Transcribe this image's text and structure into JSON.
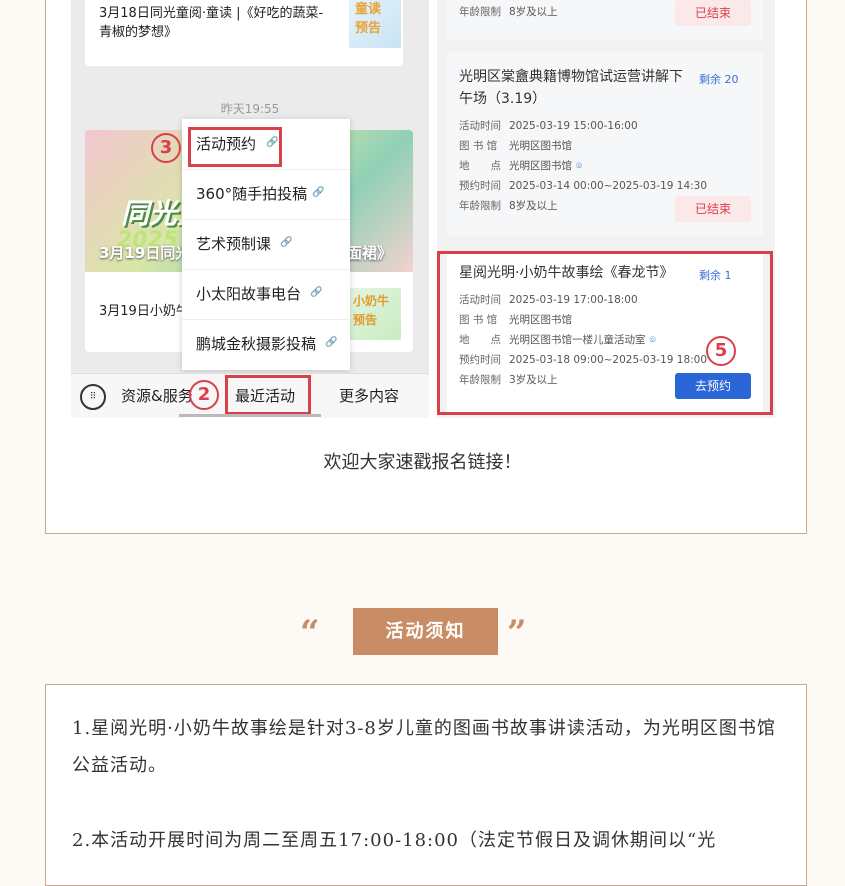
{
  "wechat_panel": {
    "card1_text": "3月18日同光童阅·童读 |《好吃的蔬菜-青椒的梦想》",
    "card1_badge": "童读\n预告",
    "timestamp": "昨天19:55",
    "banner_text": "3月19日同光",
    "banner_big": "同光童",
    "banner_year": "2025",
    "banner_right": "面裙》",
    "card2_text": "3月19日小奶牛",
    "card2_badge": "小奶牛\n预告",
    "popup_items": [
      "活动预约",
      "360°随手拍投稿",
      "艺术预制课",
      "小太阳故事电台",
      "鹏城金秋摄影投稿"
    ],
    "tabs": [
      "资源&服务",
      "最近活动",
      "更多内容"
    ],
    "markers": {
      "m2": "2",
      "m3": "3",
      "m5": "5"
    }
  },
  "activity_panel": {
    "top_card": {
      "age_key": "年龄限制",
      "age_val": "8岁及以上",
      "button": "已结束"
    },
    "card_a": {
      "title": "光明区棠盦典籍博物馆试运营讲解下午场（3.19）",
      "remain": "剩余 20",
      "rows": [
        {
          "k": "活动时间",
          "v": "2025-03-19 15:00-16:00"
        },
        {
          "k": "图 书 馆",
          "v": "光明区图书馆"
        },
        {
          "k": "地　　点",
          "v": "光明区图书馆"
        },
        {
          "k": "预约时间",
          "v": "2025-03-14 00:00~2025-03-19 14:30"
        },
        {
          "k": "年龄限制",
          "v": "8岁及以上"
        }
      ],
      "button": "已结束"
    },
    "card_b": {
      "title": "星阅光明·小奶牛故事绘《春龙节》",
      "remain": "剩余 1",
      "rows": [
        {
          "k": "活动时间",
          "v": "2025-03-19 17:00-18:00"
        },
        {
          "k": "图 书 馆",
          "v": "光明区图书馆"
        },
        {
          "k": "地　　点",
          "v": "光明区图书馆一楼儿童活动室"
        },
        {
          "k": "预约时间",
          "v": "2025-03-18 09:00~2025-03-19 18:00"
        },
        {
          "k": "年龄限制",
          "v": "3岁及以上"
        }
      ],
      "button": "去预约"
    }
  },
  "caption": "欢迎大家速戳报名链接！",
  "notice": {
    "tag": "活动须知",
    "open_quote": "“",
    "close_quote": "”",
    "para1": "1.星阅光明·小奶牛故事绘是针对3-8岁儿童的图画书故事讲读活动，为光明区图书馆公益活动。",
    "para2": "2.本活动开展时间为周二至周五17:00-18:00（法定节假日及调休期间以“光"
  },
  "colors": {
    "accent": "#c98d66",
    "red": "#d9414a",
    "blue": "#2a66d8",
    "border": "#c9a98a"
  }
}
